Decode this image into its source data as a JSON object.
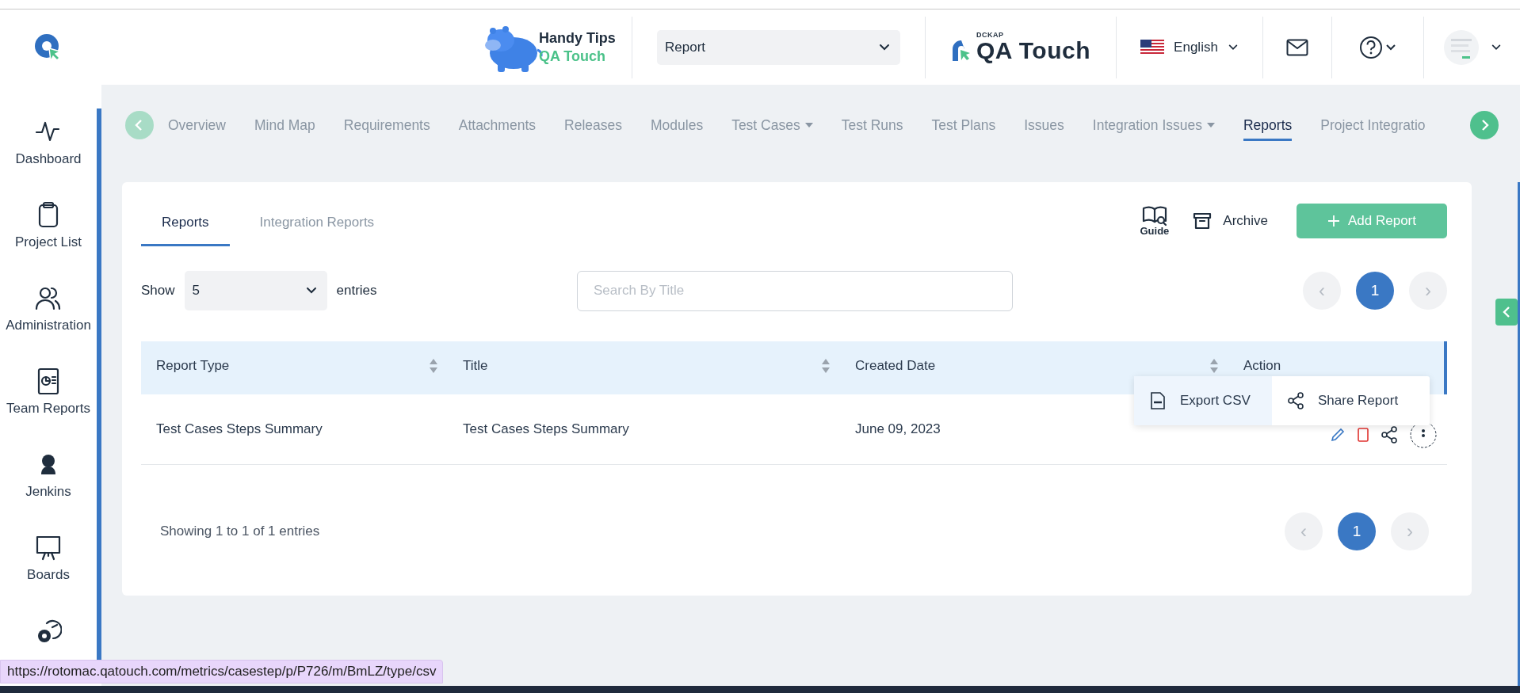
{
  "header": {
    "tips": {
      "title": "Handy Tips",
      "subtitle": "QA Touch"
    },
    "project_select": {
      "value": "Report"
    },
    "brand": {
      "company": "DCKAP",
      "product": "QA Touch"
    },
    "language": {
      "label": "English"
    }
  },
  "sidebar": {
    "items": [
      {
        "kind": "labelled",
        "label": "Dashboard"
      },
      {
        "kind": "labelled",
        "label": "Project List"
      },
      {
        "kind": "labelled",
        "label": "Administration"
      },
      {
        "kind": "labelled",
        "label": "Team Reports"
      },
      {
        "kind": "labelled",
        "label": "Jenkins"
      },
      {
        "kind": "labelled",
        "label": "Boards"
      },
      {
        "kind": "icon-only"
      }
    ]
  },
  "project_tabs": [
    {
      "label": "Overview",
      "menu": false,
      "selected": false
    },
    {
      "label": "Mind Map",
      "menu": false,
      "selected": false
    },
    {
      "label": "Requirements",
      "menu": false,
      "selected": false
    },
    {
      "label": "Attachments",
      "menu": false,
      "selected": false
    },
    {
      "label": "Releases",
      "menu": false,
      "selected": false
    },
    {
      "label": "Modules",
      "menu": false,
      "selected": false
    },
    {
      "label": "Test Cases",
      "menu": true,
      "selected": false
    },
    {
      "label": "Test Runs",
      "menu": false,
      "selected": false
    },
    {
      "label": "Test Plans",
      "menu": false,
      "selected": false
    },
    {
      "label": "Issues",
      "menu": false,
      "selected": false
    },
    {
      "label": "Integration Issues",
      "menu": true,
      "selected": false
    },
    {
      "label": "Reports",
      "menu": false,
      "selected": true
    },
    {
      "label": "Project Integratio",
      "menu": false,
      "selected": false
    }
  ],
  "card": {
    "tabs": [
      {
        "label": "Reports",
        "selected": true
      },
      {
        "label": "Integration Reports",
        "selected": false
      }
    ],
    "guide": "Guide",
    "archive": "Archive",
    "add_button": "Add Report",
    "show_label": "Show",
    "page_size": "5",
    "entries_label": "entries",
    "search": {
      "placeholder": "Search By Title"
    },
    "pagination_top": {
      "prev": "‹",
      "pages": [
        {
          "label": "1",
          "selected": true
        }
      ],
      "next": "›"
    },
    "table": {
      "columns": [
        {
          "label": "Report Type",
          "sortable": true
        },
        {
          "label": "Title",
          "sortable": true
        },
        {
          "label": "Created Date",
          "sortable": true
        },
        {
          "label": "Action",
          "sortable": false
        }
      ],
      "rows": [
        {
          "cells": [
            "Test Cases Steps Summary",
            "Test Cases Steps Summary",
            "June 09, 2023"
          ]
        }
      ]
    },
    "action_menu": [
      {
        "label": "Export CSV",
        "selected": true
      },
      {
        "label": "Share Report",
        "selected": false
      }
    ],
    "footer": {
      "summary": "Showing 1 to 1 of 1 entries",
      "pagination": {
        "prev": "‹",
        "pages": [
          {
            "label": "1",
            "selected": true
          }
        ],
        "next": "›"
      }
    }
  },
  "status_url": "https://rotomac.qatouch.com/metrics/casestep/p/P726/m/BmLZ/type/csv"
}
